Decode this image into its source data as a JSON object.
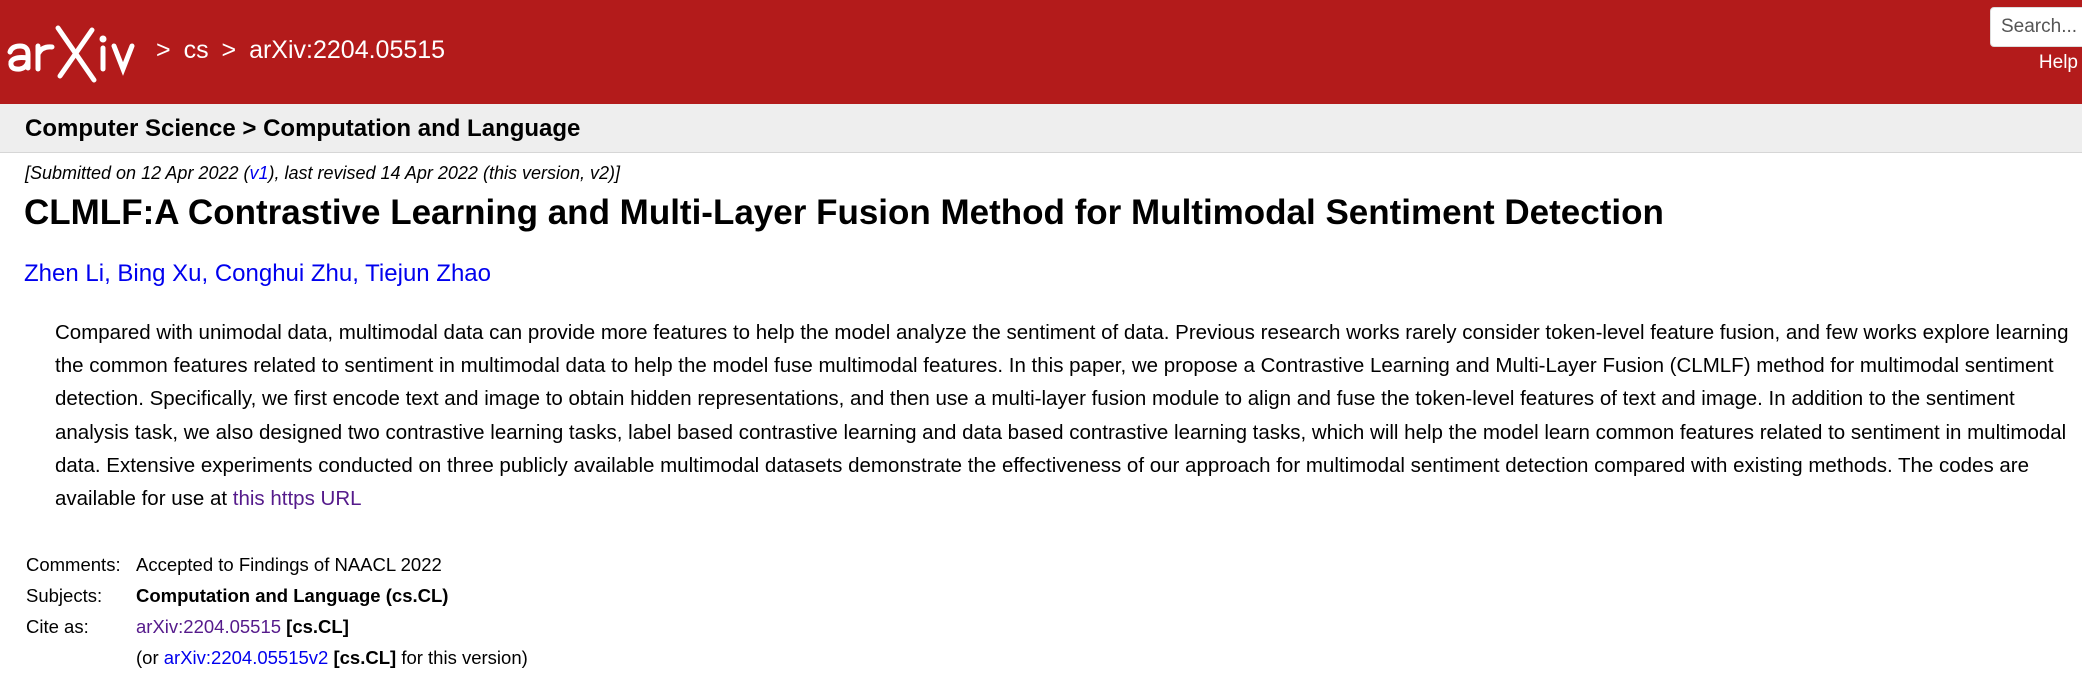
{
  "header": {
    "logo_text": "arXiv",
    "breadcrumb": [
      ">",
      "cs",
      ">",
      "arXiv:2204.05515"
    ],
    "search_placeholder": "Search...",
    "help_label": "Help",
    "background": "#b31b1b"
  },
  "subheader": {
    "category": "Computer Science > Computation and Language"
  },
  "paper": {
    "dateline_prefix": "[Submitted on 12 Apr 2022 (",
    "dateline_v1": "v1",
    "dateline_suffix": "), last revised 14 Apr 2022 (this version, v2)]",
    "title": "CLMLF:A Contrastive Learning and Multi-Layer Fusion Method for Multimodal Sentiment Detection",
    "authors": [
      "Zhen Li",
      "Bing Xu",
      "Conghui Zhu",
      "Tiejun Zhao"
    ],
    "abstract_text": "Compared with unimodal data, multimodal data can provide more features to help the model analyze the sentiment of data. Previous research works rarely consider token-level feature fusion, and few works explore learning the common features related to sentiment in multimodal data to help the model fuse multimodal features. In this paper, we propose a Contrastive Learning and Multi-Layer Fusion (CLMLF) method for multimodal sentiment detection. Specifically, we first encode text and image to obtain hidden representations, and then use a multi-layer fusion module to align and fuse the token-level features of text and image. In addition to the sentiment analysis task, we also designed two contrastive learning tasks, label based contrastive learning and data based contrastive learning tasks, which will help the model learn common features related to sentiment in multimodal data. Extensive experiments conducted on three publicly available multimodal datasets demonstrate the effectiveness of our approach for multimodal sentiment detection compared with existing methods. The codes are available for use at ",
    "abstract_link": "this https URL"
  },
  "metadata": {
    "comments_label": "Comments:",
    "comments_value": "Accepted to Findings of NAACL 2022",
    "subjects_label": "Subjects:",
    "subjects_value": "Computation and Language (cs.CL)",
    "cite_label": "Cite as:",
    "cite_id": "arXiv:2204.05515",
    "cite_cat": "[cs.CL]",
    "cite2_prefix": "(or ",
    "cite2_id": "arXiv:2204.05515v2",
    "cite2_cat": "[cs.CL]",
    "cite2_suffix": "for this version)"
  }
}
